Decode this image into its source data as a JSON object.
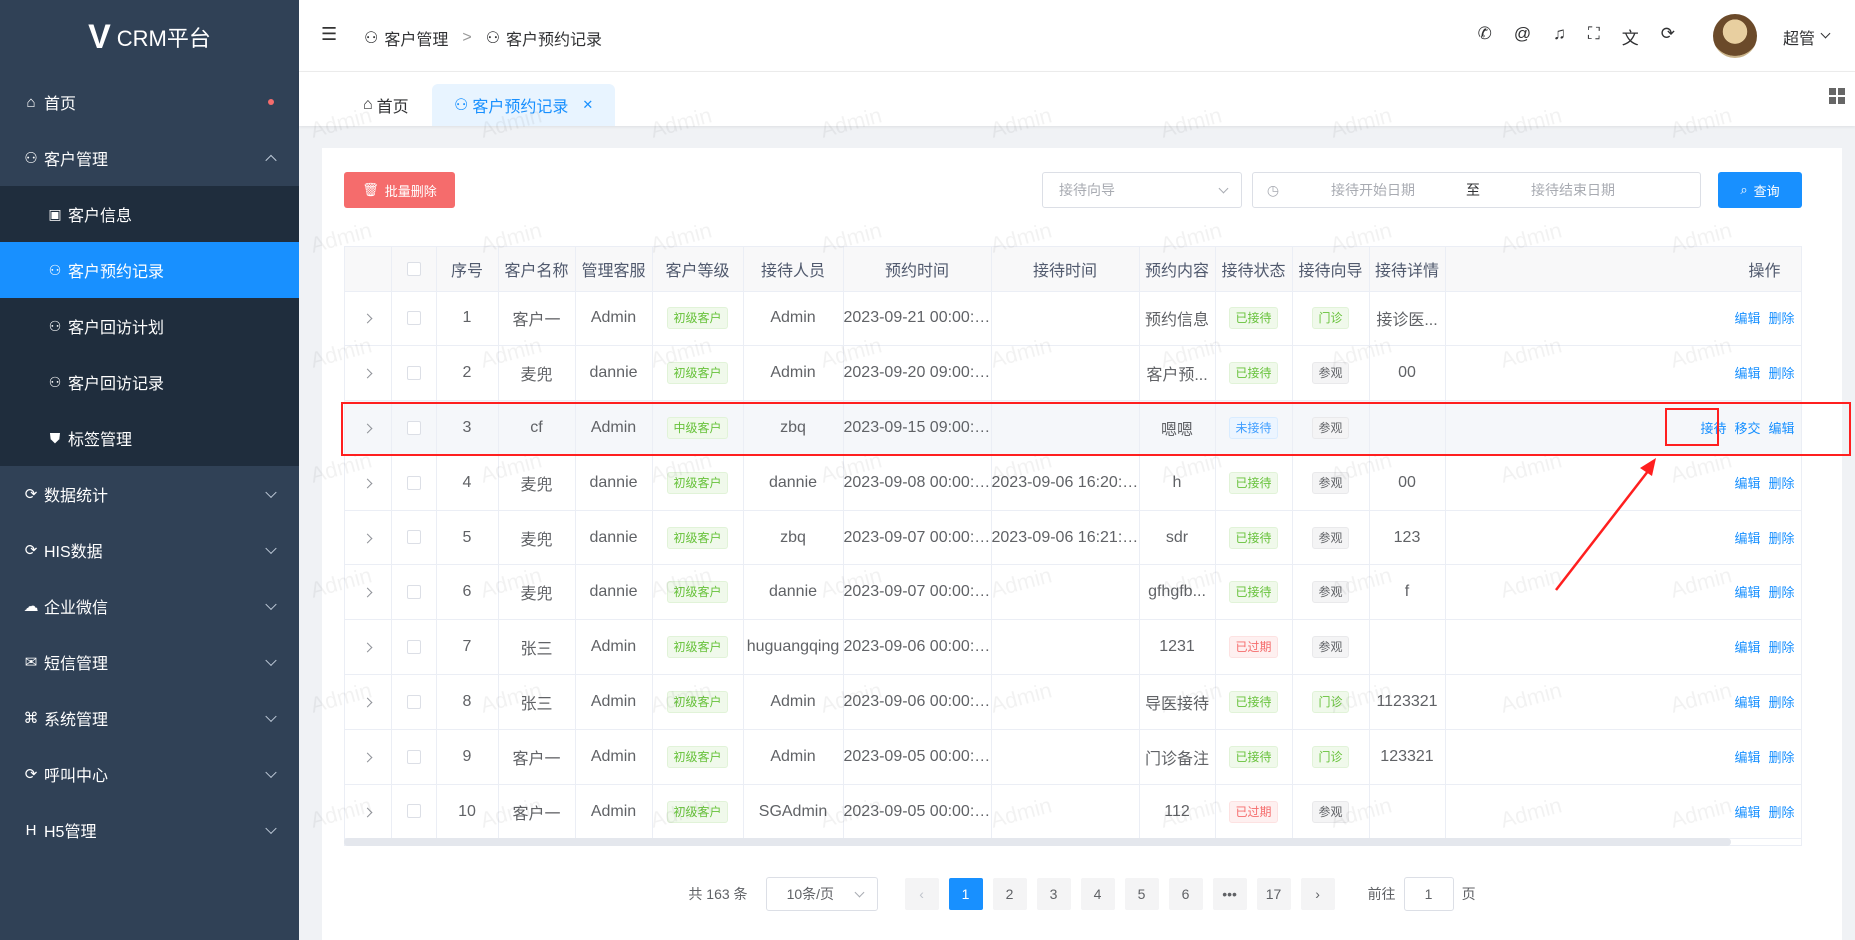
{
  "brand": {
    "name": "CRM平台"
  },
  "sidebar": {
    "items": [
      {
        "label": "首页",
        "icon": "home-icon"
      },
      {
        "label": "客户管理",
        "icon": "user-icon"
      },
      {
        "label": "客户信息",
        "icon": "id-card-icon"
      },
      {
        "label": "客户预约记录",
        "icon": "user-icon"
      },
      {
        "label": "客户回访计划",
        "icon": "user-icon"
      },
      {
        "label": "客户回访记录",
        "icon": "user-icon"
      },
      {
        "label": "标签管理",
        "icon": "shield-icon"
      },
      {
        "label": "数据统计",
        "icon": "refresh-icon"
      },
      {
        "label": "HIS数据",
        "icon": "refresh-icon"
      },
      {
        "label": "企业微信",
        "icon": "chat-icon"
      },
      {
        "label": "短信管理",
        "icon": "message-icon"
      },
      {
        "label": "系统管理",
        "icon": "command-icon"
      },
      {
        "label": "呼叫中心",
        "icon": "refresh-icon"
      },
      {
        "label": "H5管理",
        "icon": "h5-icon"
      }
    ]
  },
  "header": {
    "breadcrumb": [
      "客户管理",
      "客户预约记录"
    ],
    "user_name": "超管"
  },
  "tags": {
    "home": "首页",
    "active": "客户预约记录"
  },
  "toolbar": {
    "batch_delete": "批量删除",
    "guide_placeholder": "接待向导",
    "date_start_placeholder": "接待开始日期",
    "date_to": "至",
    "date_end_placeholder": "接待结束日期",
    "query": "查询"
  },
  "table": {
    "columns": [
      "序号",
      "客户名称",
      "管理客服",
      "客户等级",
      "接待人员",
      "预约时间",
      "接待时间",
      "预约内容",
      "接待状态",
      "接待向导",
      "接待详情",
      "操作"
    ],
    "rows": [
      {
        "no": "1",
        "name": "客户一",
        "cs": "Admin",
        "level": "初级客户",
        "staff": "Admin",
        "appt": "2023-09-21 00:00:00",
        "recv": "",
        "content": "预约信息",
        "status": "已接待",
        "guide": "门诊",
        "detail": "接诊医...",
        "ops": [
          "编辑",
          "删除"
        ]
      },
      {
        "no": "2",
        "name": "麦兜",
        "cs": "dannie",
        "level": "初级客户",
        "staff": "Admin",
        "appt": "2023-09-20 09:00:00",
        "recv": "",
        "content": "客户预...",
        "status": "已接待",
        "guide": "参观",
        "detail": "00",
        "ops": [
          "编辑",
          "删除"
        ]
      },
      {
        "no": "3",
        "name": "cf",
        "cs": "Admin",
        "level": "中级客户",
        "staff": "zbq",
        "appt": "2023-09-15 09:00:00",
        "recv": "",
        "content": "嗯嗯",
        "status": "未接待",
        "guide": "参观",
        "detail": "",
        "ops": [
          "接待",
          "移交",
          "编辑"
        ]
      },
      {
        "no": "4",
        "name": "麦兜",
        "cs": "dannie",
        "level": "初级客户",
        "staff": "dannie",
        "appt": "2023-09-08 00:00:00",
        "recv": "2023-09-06 16:20:44",
        "content": "h",
        "status": "已接待",
        "guide": "参观",
        "detail": "00",
        "ops": [
          "编辑",
          "删除"
        ]
      },
      {
        "no": "5",
        "name": "麦兜",
        "cs": "dannie",
        "level": "初级客户",
        "staff": "zbq",
        "appt": "2023-09-07 00:00:00",
        "recv": "2023-09-06 16:21:04",
        "content": "sdr",
        "status": "已接待",
        "guide": "参观",
        "detail": "123",
        "ops": [
          "编辑",
          "删除"
        ]
      },
      {
        "no": "6",
        "name": "麦兜",
        "cs": "dannie",
        "level": "初级客户",
        "staff": "dannie",
        "appt": "2023-09-07 00:00:00",
        "recv": "",
        "content": "gfhgfb...",
        "status": "已接待",
        "guide": "参观",
        "detail": "f",
        "ops": [
          "编辑",
          "删除"
        ]
      },
      {
        "no": "7",
        "name": "张三",
        "cs": "Admin",
        "level": "初级客户",
        "staff": "huguangqing",
        "appt": "2023-09-06 00:00:00",
        "recv": "",
        "content": "1231",
        "status": "已过期",
        "guide": "参观",
        "detail": "",
        "ops": [
          "编辑",
          "删除"
        ]
      },
      {
        "no": "8",
        "name": "张三",
        "cs": "Admin",
        "level": "初级客户",
        "staff": "Admin",
        "appt": "2023-09-06 00:00:00",
        "recv": "",
        "content": "导医接待",
        "status": "已接待",
        "guide": "门诊",
        "detail": "1123321",
        "ops": [
          "编辑",
          "删除"
        ]
      },
      {
        "no": "9",
        "name": "客户一",
        "cs": "Admin",
        "level": "初级客户",
        "staff": "Admin",
        "appt": "2023-09-05 00:00:00",
        "recv": "",
        "content": "门诊备注",
        "status": "已接待",
        "guide": "门诊",
        "detail": "123321",
        "ops": [
          "编辑",
          "删除"
        ]
      },
      {
        "no": "10",
        "name": "客户一",
        "cs": "Admin",
        "level": "初级客户",
        "staff": "SGAdmin",
        "appt": "2023-09-05 00:00:00",
        "recv": "",
        "content": "112",
        "status": "已过期",
        "guide": "参观",
        "detail": "",
        "ops": [
          "编辑",
          "删除"
        ]
      }
    ]
  },
  "pagination": {
    "total": "共 163 条",
    "page_size": "10条/页",
    "pages": [
      "1",
      "2",
      "3",
      "4",
      "5",
      "6",
      "17"
    ],
    "current": "1",
    "goto_label": "前往",
    "goto_value": "1",
    "goto_suffix": "页"
  },
  "watermark": "Admin",
  "colors": {
    "primary": "#1890ff",
    "sidebar": "#304156",
    "danger": "#f56c6c",
    "annotation": "#ff1f1f"
  }
}
